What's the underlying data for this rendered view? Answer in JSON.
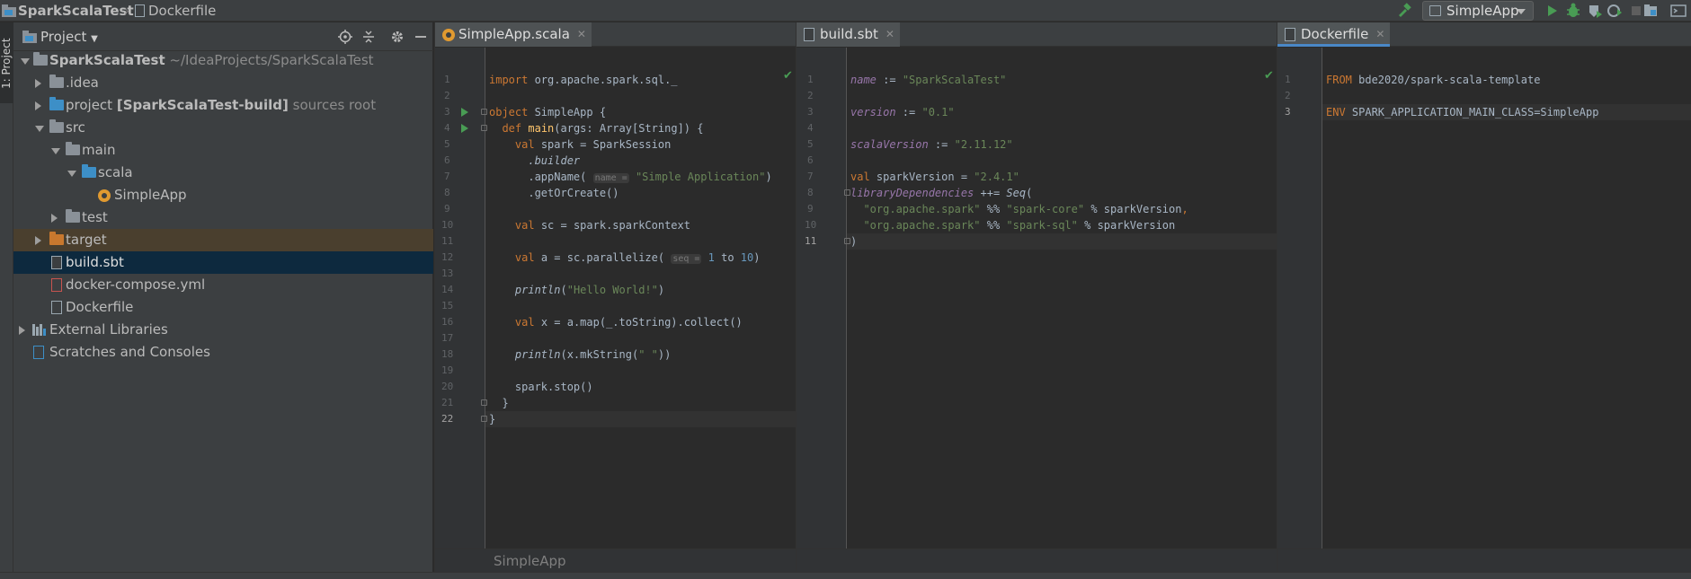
{
  "navbar": {
    "project": "SparkScalaTest",
    "file": "Dockerfile",
    "run_config": "SimpleApp"
  },
  "tool_window": {
    "project_tab": "1: Project"
  },
  "project_panel": {
    "title": "Project",
    "tree": {
      "root_name": "SparkScalaTest",
      "root_path": "~/IdeaProjects/SparkScalaTest",
      "idea": ".idea",
      "project_prefix": "project ",
      "project_module": "[SparkScalaTest-build]",
      "project_suffix": "sources root",
      "src": "src",
      "main": "main",
      "scala": "scala",
      "simpleapp": "SimpleApp",
      "test": "test",
      "target": "target",
      "build_sbt": "build.sbt",
      "docker_compose": "docker-compose.yml",
      "dockerfile": "Dockerfile",
      "external_libraries": "External Libraries",
      "scratches": "Scratches and Consoles"
    }
  },
  "editor1": {
    "tab": "SimpleApp.scala",
    "breadcrumb": "SimpleApp",
    "hint_name": "name =",
    "hint_seq": "seq ="
  },
  "editor2": {
    "tab": "build.sbt"
  },
  "editor3": {
    "tab": "Dockerfile"
  },
  "colors": {
    "background": "#2b2b2b",
    "panel": "#3c3f41",
    "selection": "#0d293e",
    "keyword": "#cc7832",
    "string": "#6a8759",
    "number": "#6897bb",
    "accent": "#4a88c7"
  }
}
